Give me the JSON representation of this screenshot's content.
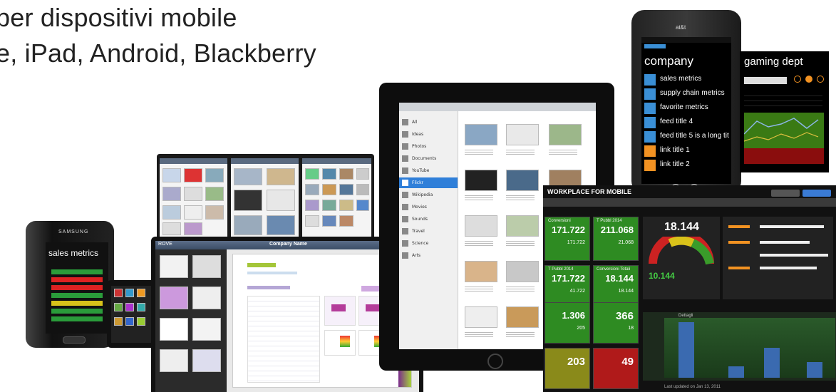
{
  "headline": {
    "line1": "per dispositivi mobile",
    "line2": "e, iPad, Android, Blackberry"
  },
  "samsung_phone": {
    "brand": "SAMSUNG",
    "title": "sales metrics",
    "colors": [
      "#2a9c3a",
      "#d22",
      "#d22",
      "#2a9c3a",
      "#d7c21a",
      "#2a9c3a",
      "#2a9c3a"
    ]
  },
  "windows_phone": {
    "carrier": "at&t",
    "panorama_title": "company",
    "items": [
      {
        "label": "sales metrics",
        "color": "#3a8fd6"
      },
      {
        "label": "supply chain metrics",
        "color": "#3a8fd6"
      },
      {
        "label": "favorite metrics",
        "color": "#3a8fd6"
      },
      {
        "label": "feed title 4",
        "color": "#3a8fd6"
      },
      {
        "label": "feed title 5 is a long tit",
        "color": "#3a8fd6"
      },
      {
        "label": "link title 1",
        "color": "#f29222"
      },
      {
        "label": "link title 2",
        "color": "#f29222"
      }
    ],
    "second_panel_title": "gaming dept"
  },
  "tablet_center": {
    "header": "Company Name",
    "app_label": "ROVE"
  },
  "ipad": {
    "sidebar_items": [
      "All",
      "Ideas",
      "Photos",
      "Documents",
      "YouTube",
      "Flickr",
      "Wikipedia",
      "Movies",
      "Sounds",
      "Travel",
      "Science",
      "Arts"
    ],
    "selected_index": 5
  },
  "dashboard": {
    "brand": "WORKPLACE FOR MOBILE",
    "gauge_value": "18.144",
    "gauge_sub": "10.144",
    "tiles": [
      {
        "label": "Conversioni",
        "value": "171.722",
        "sub": "171.722",
        "color": "#2e8b22"
      },
      {
        "label": "T Pubbl 2014",
        "value": "211.068",
        "sub": "21.068",
        "color": "#2e8b22"
      },
      {
        "label": "T Pubbl 2014",
        "value": "171.722",
        "sub": "41.722",
        "color": "#2e8b22"
      },
      {
        "label": "Conversioni Totali",
        "value": "18.144",
        "sub": "18.144",
        "color": "#2e8b22"
      },
      {
        "label": "",
        "value": "1.306",
        "sub": "205",
        "color": "#2e8b22"
      },
      {
        "label": "",
        "value": "366",
        "sub": "18",
        "color": "#2e8b22"
      },
      {
        "label": "",
        "value": "203",
        "sub": "",
        "color": "#8a8a1a"
      },
      {
        "label": "",
        "value": "49",
        "sub": "",
        "color": "#b01a1a"
      }
    ],
    "bar_chart_label": "Dettagli",
    "footer": "Last updated on Jan 13, 2011"
  }
}
